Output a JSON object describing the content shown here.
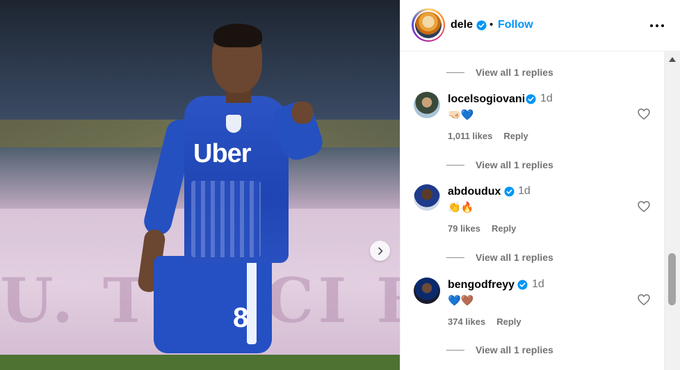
{
  "post": {
    "username": "dele",
    "follow_label": "Follow",
    "separator": "•",
    "media": {
      "jersey_sponsor": "Uber",
      "jersey_number": "8",
      "board_text": "U. TURCI BENE"
    }
  },
  "comments": [
    {
      "replies_label": "View all 1 replies"
    },
    {
      "username": "locelsogiovani",
      "time": "1d",
      "text": "🤜🏻💙",
      "likes": "1,011 likes",
      "reply_label": "Reply",
      "replies_label": "View all 1 replies",
      "avatar_color": "#2d3b2d"
    },
    {
      "username": "abdoudux",
      "time": "1d",
      "text": "👏🔥",
      "likes": "79 likes",
      "reply_label": "Reply",
      "replies_label": "View all 1 replies",
      "avatar_color": "#1e3a8a"
    },
    {
      "username": "bengodfreyy",
      "time": "1d",
      "text": "💙🤎",
      "likes": "374 likes",
      "reply_label": "Reply",
      "replies_label": "View all 1 replies",
      "avatar_color": "#0b2a6b"
    }
  ],
  "colors": {
    "accent": "#0095f6",
    "verified": "#0095f6",
    "secondary_text": "#737373"
  }
}
